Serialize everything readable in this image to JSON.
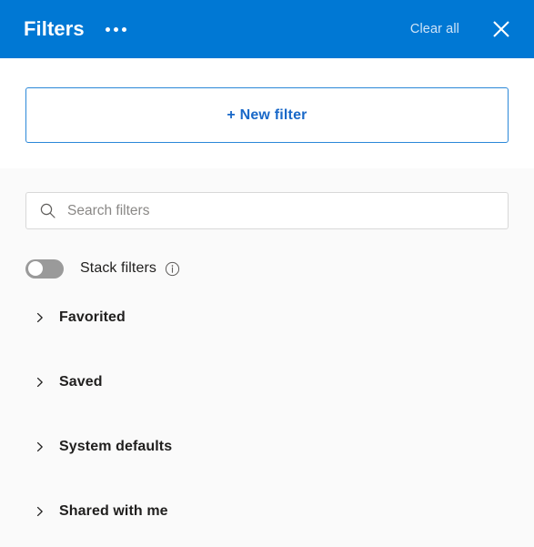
{
  "header": {
    "title": "Filters",
    "overflow_icon": "ellipsis-icon",
    "clear_all_label": "Clear all",
    "close_icon": "close-icon",
    "background_color": "#0078D4",
    "title_color": "#FFFFFF",
    "clear_all_color": "#CFE4F7"
  },
  "new_filter": {
    "label": "+ New filter",
    "accent_color": "#1968C8",
    "border_color": "#2B88D8"
  },
  "search": {
    "icon": "search-icon",
    "placeholder": "Search filters",
    "value": ""
  },
  "stack_filters": {
    "label": "Stack filters",
    "state": "off",
    "toggle_track_color": "#9A9A9A",
    "info_icon": "info-icon"
  },
  "groups": [
    {
      "label": "Favorited",
      "expanded": false,
      "icon": "chevron-right-icon"
    },
    {
      "label": "Saved",
      "expanded": false,
      "icon": "chevron-right-icon"
    },
    {
      "label": "System defaults",
      "expanded": false,
      "icon": "chevron-right-icon"
    },
    {
      "label": "Shared with me",
      "expanded": false,
      "icon": "chevron-right-icon"
    }
  ],
  "panel": {
    "background_color": "#FAFAFA"
  }
}
